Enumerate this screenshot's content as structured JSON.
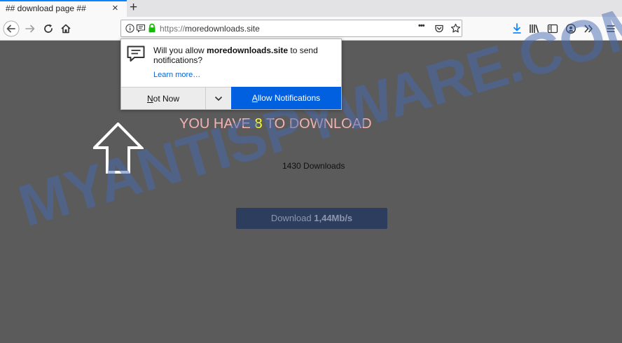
{
  "tab": {
    "title": "## download page ##",
    "close_glyph": "×",
    "new_tab_glyph": "+"
  },
  "address_bar": {
    "scheme": "https://",
    "host": "moredownloads.site",
    "more_glyph": "•••"
  },
  "icons": [
    "back-arrow-icon",
    "forward-arrow-icon",
    "reload-icon",
    "home-icon",
    "info-icon",
    "notification-permission-icon",
    "lock-icon",
    "pocket-icon",
    "bookmark-star-icon",
    "download-icon",
    "library-icon",
    "sidebar-icon",
    "account-icon",
    "overflow-chevron-icon",
    "hamburger-menu-icon",
    "chat-bubble-icon",
    "up-arrow-icon"
  ],
  "colors": {
    "accent": "#0a84ff",
    "allow_button": "#0060df",
    "lock": "#12bc00",
    "headline": "#f4b2b2",
    "headline_number": "#ffff33",
    "watermark": "#4669af"
  },
  "notification_popup": {
    "prefix": "Will you allow ",
    "site": "moredownloads.site",
    "suffix": " to send notifications?",
    "learn_more": "Learn more…",
    "not_now_first": "N",
    "not_now_rest": "ot Now",
    "allow_first": "A",
    "allow_rest": "llow Notifications"
  },
  "page": {
    "headline_before": "YOU HAVE ",
    "headline_number": "8",
    "headline_after": " TO DOWNLOAD",
    "downloads_count": "1430 Downloads",
    "button_label": "Download ",
    "button_speed": "1,44Mb/s",
    "watermark": "MYANTISPYWARE.COM"
  }
}
